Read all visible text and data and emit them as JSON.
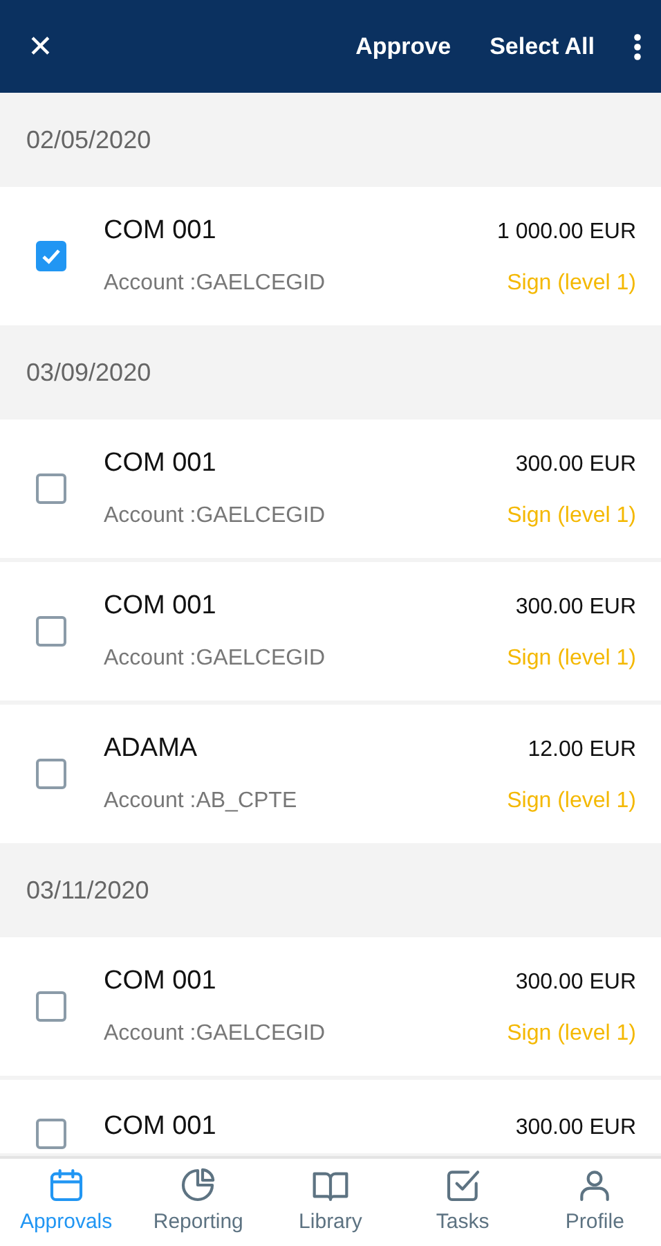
{
  "toolbar": {
    "close": "✕",
    "actions": [
      "Approve",
      "Select All"
    ]
  },
  "groups": [
    {
      "date": "02/05/2020",
      "items": [
        {
          "name": "COM 001",
          "account": "Account :GAELCEGID",
          "amount": "1 000.00 EUR",
          "status": "Sign (level 1)",
          "checked": true
        }
      ]
    },
    {
      "date": "03/09/2020",
      "items": [
        {
          "name": "COM 001",
          "account": "Account :GAELCEGID",
          "amount": "300.00 EUR",
          "status": "Sign (level 1)",
          "checked": false
        },
        {
          "name": "COM 001",
          "account": "Account :GAELCEGID",
          "amount": "300.00 EUR",
          "status": "Sign (level 1)",
          "checked": false
        },
        {
          "name": "ADAMA",
          "account": "Account :AB_CPTE",
          "amount": "12.00 EUR",
          "status": "Sign (level 1)",
          "checked": false
        }
      ]
    },
    {
      "date": "03/11/2020",
      "items": [
        {
          "name": "COM 001",
          "account": "Account :GAELCEGID",
          "amount": "300.00 EUR",
          "status": "Sign (level 1)",
          "checked": false
        },
        {
          "name": "COM 001",
          "amount": "300.00 EUR",
          "checked": false
        }
      ]
    }
  ],
  "tabs": [
    {
      "label": "Approvals",
      "kind": "calendar",
      "selected": true
    },
    {
      "label": "Reporting",
      "kind": "chart",
      "selected": false
    },
    {
      "label": "Library",
      "kind": "book",
      "selected": false
    },
    {
      "label": "Tasks",
      "kind": "task",
      "selected": false
    },
    {
      "label": "Profile",
      "kind": "person",
      "selected": false
    }
  ]
}
